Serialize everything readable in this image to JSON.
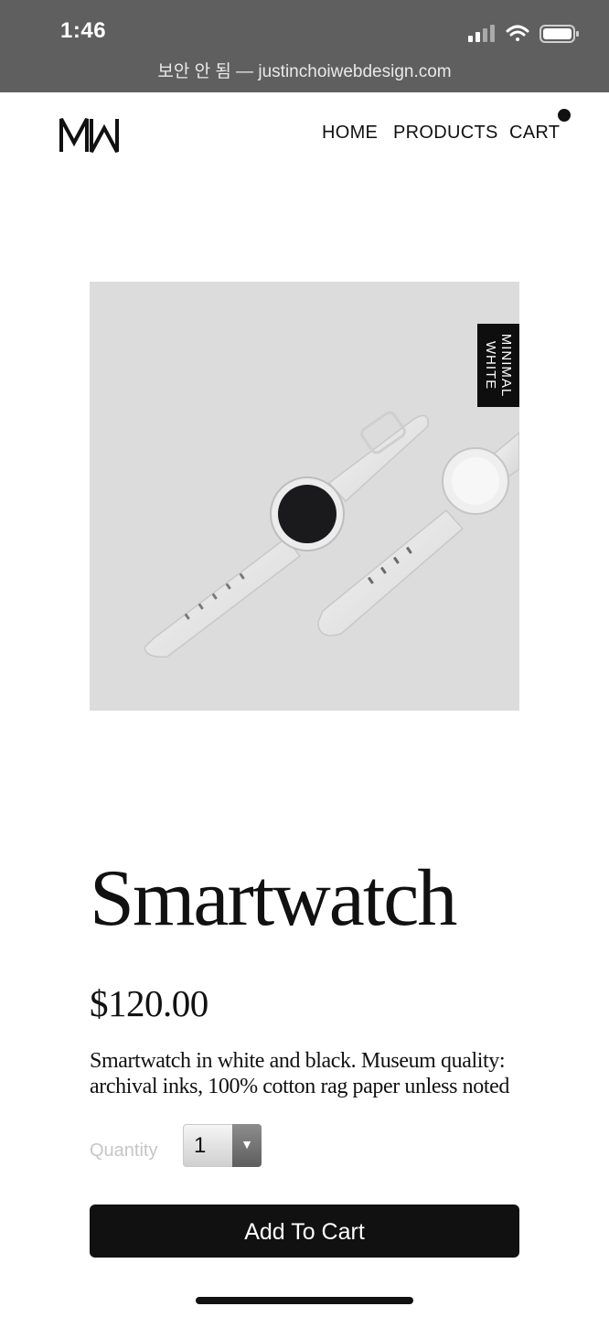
{
  "status_bar": {
    "time": "1:46",
    "icons": [
      "cellular-signal-icon",
      "wifi-icon",
      "battery-icon"
    ]
  },
  "browser": {
    "url_text": "보안 안 됨 — justinchoiwebdesign.com"
  },
  "header": {
    "logo_icon": "mw-logo-icon",
    "nav": {
      "home": "HOME",
      "products": "PRODUCTS",
      "cart": "CART"
    },
    "cart_has_items_indicator": true
  },
  "product": {
    "image_tag_line1": "MINIMAL",
    "image_tag_line2": "WHITE",
    "title": "Smartwatch",
    "price": "$120.00",
    "description": "Smartwatch in white and black. Museum quality: archival inks, 100% cotton rag paper unless noted",
    "quantity_label": "Quantity",
    "quantity_value": "1",
    "add_to_cart_label": "Add To Cart"
  },
  "colors": {
    "status_bar_bg": "#5f5f5f",
    "button_bg": "#111111",
    "image_bg": "#dcdcdd",
    "label_muted": "#c6c6c6"
  }
}
